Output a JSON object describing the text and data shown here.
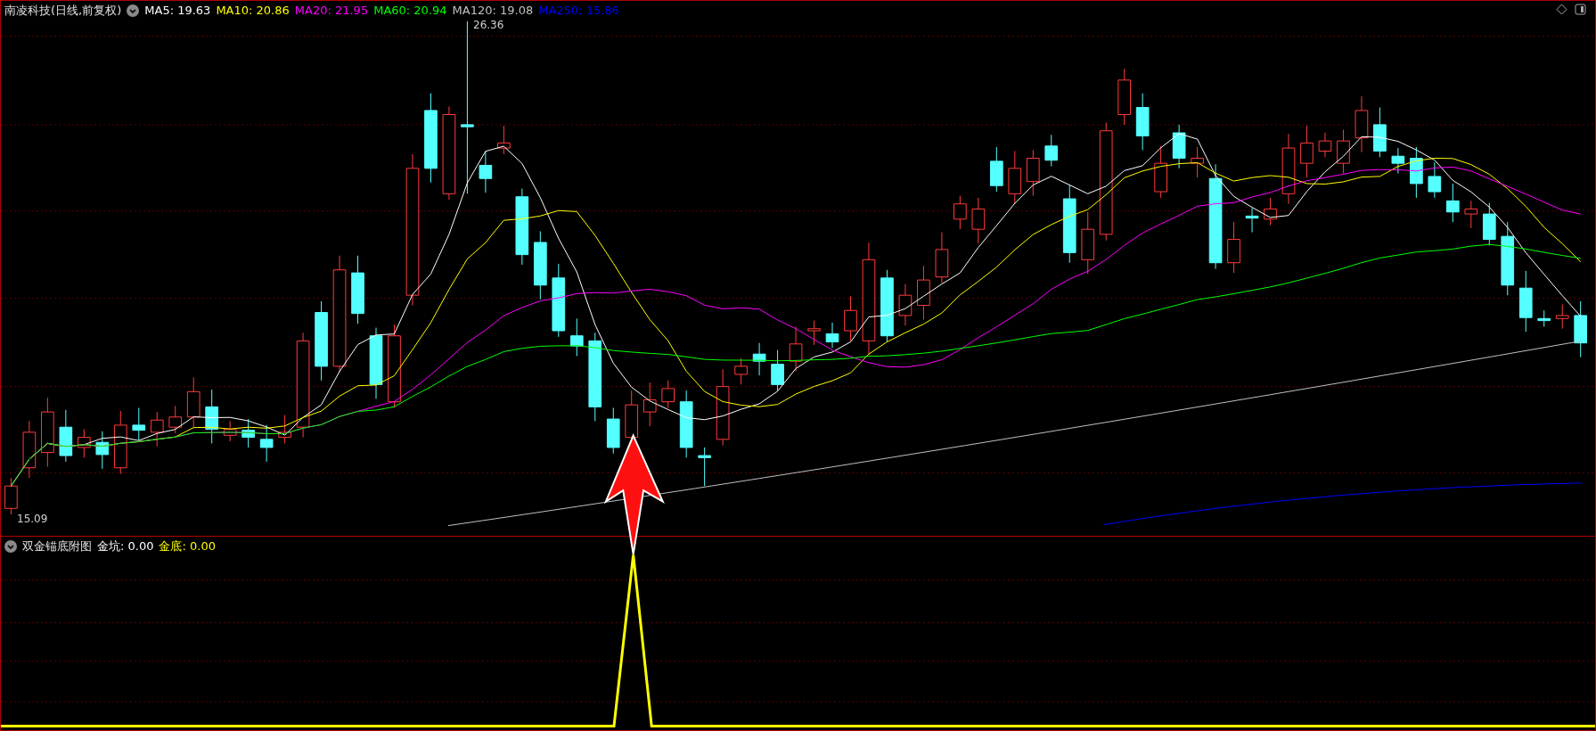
{
  "main_panel": {
    "title": "南凌科技(日线,前复权)",
    "indicators": [
      {
        "text": "MA5: 19.63",
        "color": "#ffffff"
      },
      {
        "text": "MA10: 20.86",
        "color": "#ffff00"
      },
      {
        "text": "MA20: 21.95",
        "color": "#ff00ff"
      },
      {
        "text": "MA60: 20.94",
        "color": "#00ff00"
      },
      {
        "text": "MA120: 19.08",
        "color": "#c0c0c0"
      },
      {
        "text": "MA250: 15.86",
        "color": "#0000ff"
      }
    ],
    "high_label": "26.36",
    "low_label": "15.09"
  },
  "sub_panel": {
    "title": "双金锚底附图",
    "indicators": [
      {
        "text": "金坑: 0.00",
        "color": "#ffffff"
      },
      {
        "text": "金底: 0.00",
        "color": "#ffff00"
      }
    ]
  }
}
